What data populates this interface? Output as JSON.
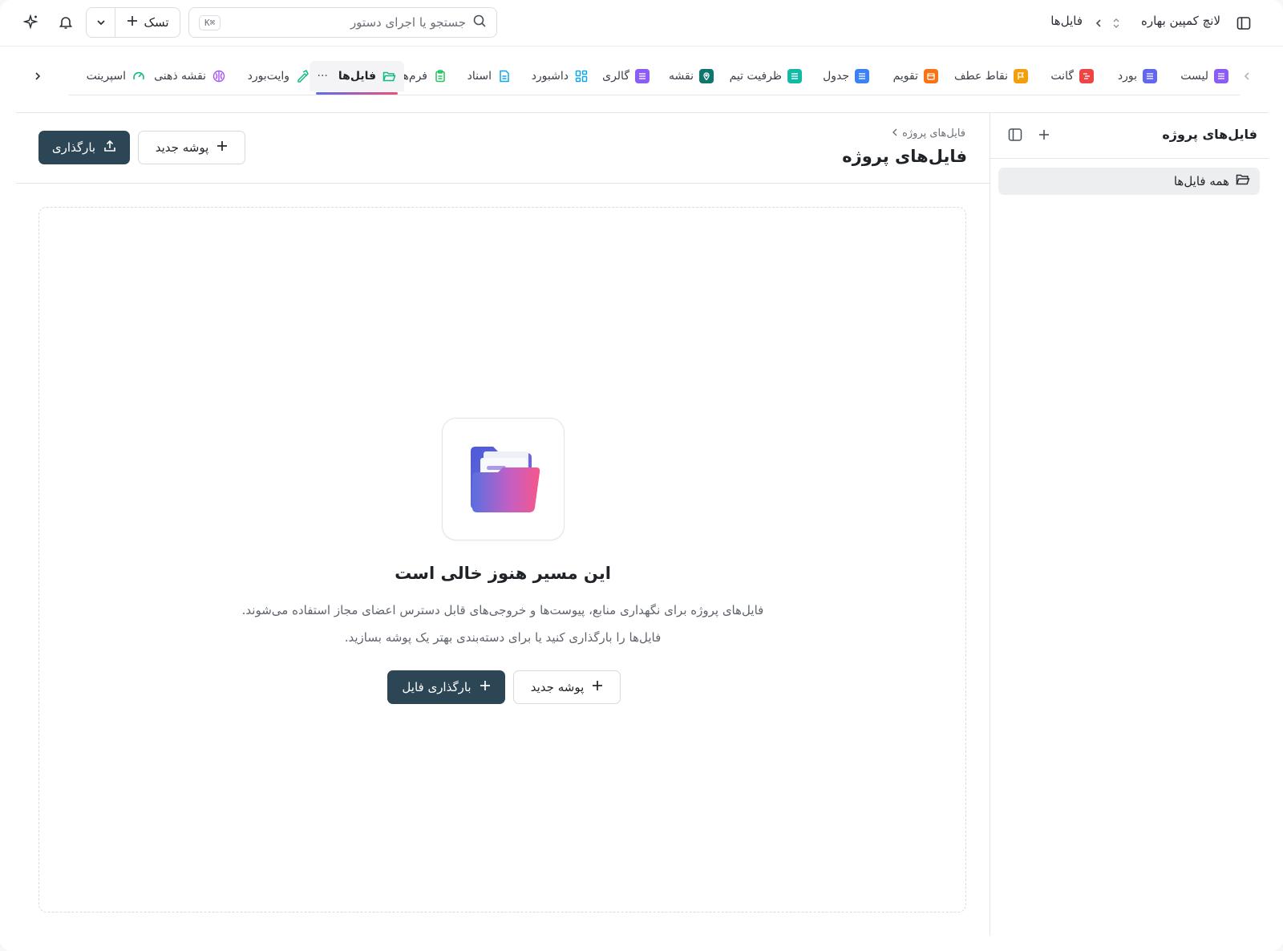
{
  "topbar": {
    "project_name": "لانچ کمپین بهاره",
    "current_page": "فایل‌ها",
    "search_placeholder": "جستجو یا اجرای دستور",
    "search_shortcut": "⌘K",
    "task_button": "تسک"
  },
  "tabs": [
    {
      "label": "لیست",
      "icon": "list-icon",
      "color": "#8b5cf6"
    },
    {
      "label": "بورد",
      "icon": "board-icon",
      "color": "#6366f1"
    },
    {
      "label": "گانت",
      "icon": "gantt-icon",
      "color": "#ef4444"
    },
    {
      "label": "نقاط عطف",
      "icon": "flag-icon",
      "color": "#f59e0b"
    },
    {
      "label": "تقویم",
      "icon": "calendar-icon",
      "color": "#f97316"
    },
    {
      "label": "جدول",
      "icon": "table-icon",
      "color": "#3b82f6"
    },
    {
      "label": "ظرفیت تیم",
      "icon": "team-capacity-icon",
      "color": "#14b8a6"
    },
    {
      "label": "نقشه",
      "icon": "map-pin-icon",
      "color": "#0f766e"
    },
    {
      "label": "گالری",
      "icon": "gallery-icon",
      "color": "#8b5cf6"
    },
    {
      "label": "داشبورد",
      "icon": "dashboard-icon",
      "color": "#0ea5e9"
    },
    {
      "label": "اسناد",
      "icon": "document-icon",
      "color": "#0ea5e9"
    },
    {
      "label": "فرم‌ها",
      "icon": "form-icon",
      "color": "#22c55e"
    },
    {
      "label": "فایل‌ها",
      "icon": "folder-icon",
      "color": "#10b981",
      "active": true
    },
    {
      "label": "وایت‌بورد",
      "icon": "whiteboard-icon",
      "color": "#10b981"
    },
    {
      "label": "نقشه ذهنی",
      "icon": "mind-map-icon",
      "color": "#a855f7"
    },
    {
      "label": "اسپرینت",
      "icon": "sprint-gauge-icon",
      "color": "#10b981"
    }
  ],
  "sidebar": {
    "title": "فایل‌های پروژه",
    "items": [
      {
        "label": "همه فایل‌ها"
      }
    ]
  },
  "main": {
    "breadcrumb": "فایل‌های پروژه",
    "title": "فایل‌های پروژه",
    "upload_button": "بارگذاری",
    "new_folder_button": "پوشه جدید"
  },
  "empty_state": {
    "title": "این مسیر هنوز خالی است",
    "line1": "فایل‌های پروژه برای نگهداری منابع، پیوست‌ها و خروجی‌های قابل دسترس اعضای مجاز استفاده می‌شوند.",
    "line2": "فایل‌ها را بارگذاری کنید یا برای دسته‌بندی بهتر یک پوشه بسازید.",
    "new_folder_button": "پوشه جدید",
    "upload_file_button": "بارگذاری فایل"
  },
  "colors": {
    "primary": "#2c4656",
    "accent_gradient_start": "#5b6ee8",
    "accent_gradient_end": "#f04f7a"
  }
}
